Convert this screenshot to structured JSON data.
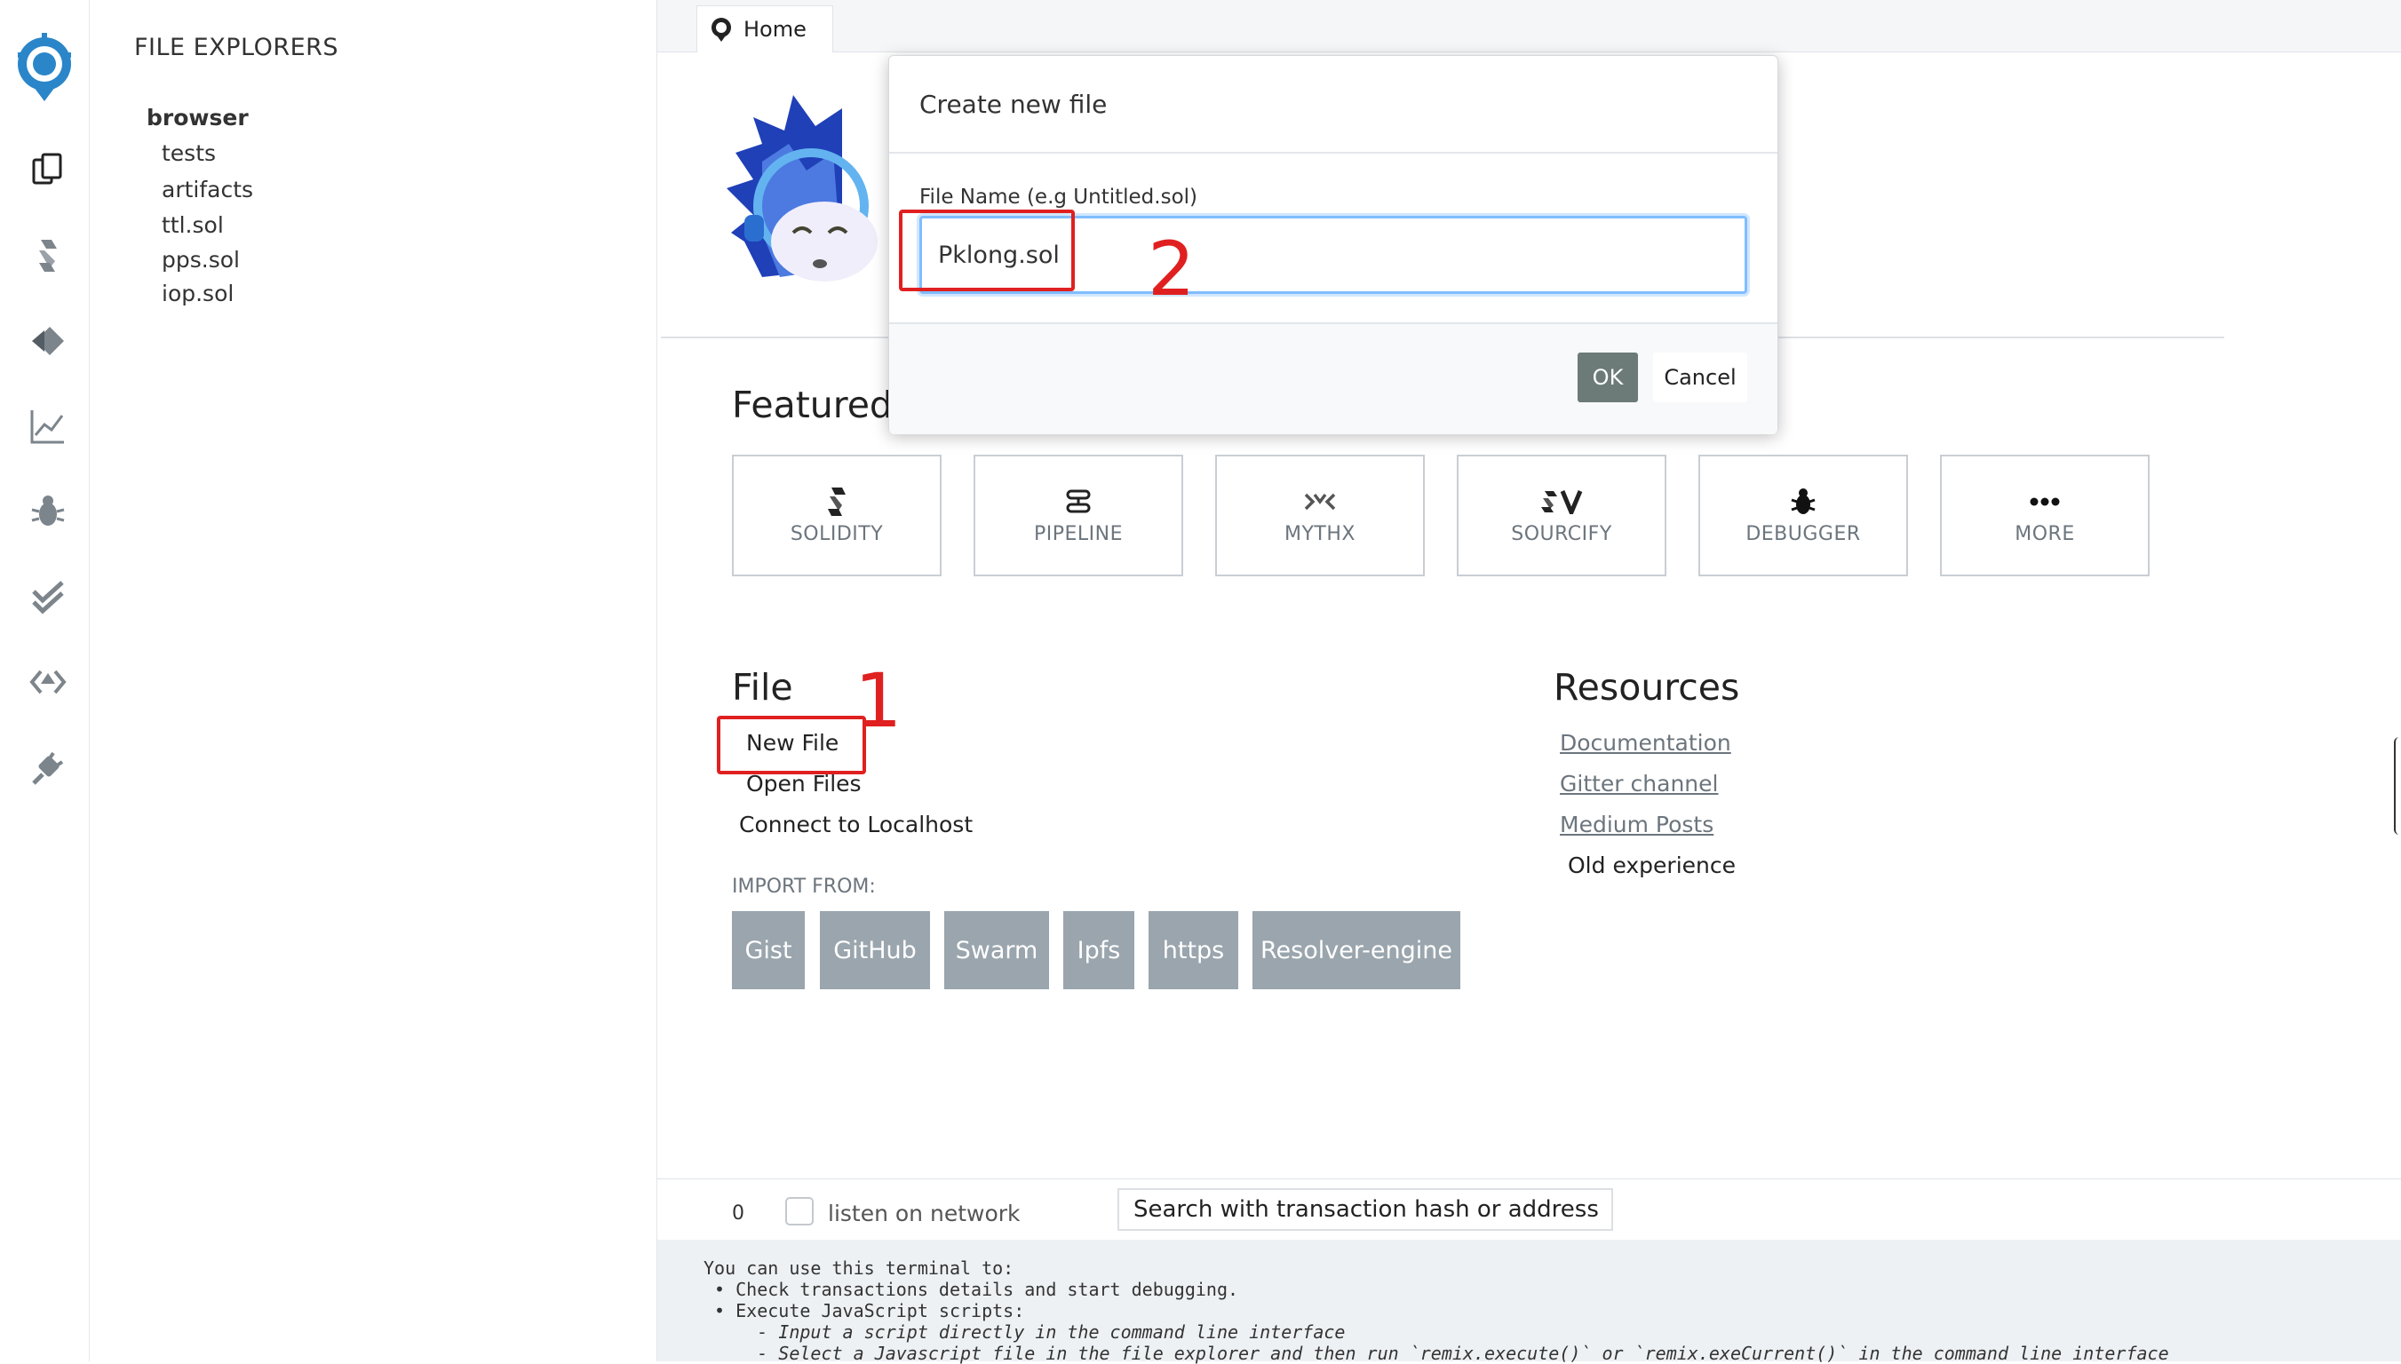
{
  "explorer": {
    "title": "FILE EXPLORERS",
    "root": "browser",
    "items": [
      "tests",
      "artifacts",
      "ttl.sol",
      "pps.sol",
      "iop.sol"
    ]
  },
  "tabs": [
    {
      "label": "Home"
    }
  ],
  "home": {
    "featured_title": "Featured",
    "plugins": [
      {
        "label": "SOLIDITY",
        "icon": "solidity-icon"
      },
      {
        "label": "PIPELINE",
        "icon": "pipeline-icon"
      },
      {
        "label": "MYTHX",
        "icon": "mythx-icon"
      },
      {
        "label": "SOURCIFY",
        "icon": "sourcify-icon"
      },
      {
        "label": "DEBUGGER",
        "icon": "bug-icon"
      },
      {
        "label": "MORE",
        "icon": "more-icon"
      }
    ],
    "file_title": "File",
    "file_links": [
      "New File",
      "Open Files",
      "Connect to Localhost"
    ],
    "import_label": "IMPORT FROM:",
    "import_buttons": [
      "Gist",
      "GitHub",
      "Swarm",
      "Ipfs",
      "https",
      "Resolver-engine"
    ],
    "resources_title": "Resources",
    "resource_links": [
      "Documentation",
      "Gitter channel",
      "Medium Posts"
    ],
    "old_experience": "Old experience"
  },
  "terminal": {
    "counter": "0",
    "listen_label": "listen on network",
    "search_placeholder": "Search with transaction hash or address",
    "lines": [
      "You can use this terminal to:",
      " • Check transactions details and start debugging.",
      " • Execute JavaScript scripts:",
      "     - Input a script directly in the command line interface",
      "     - Select a Javascript file in the file explorer and then run `remix.execute()` or `remix.exeCurrent()` in the command line interface"
    ]
  },
  "modal": {
    "title": "Create new file",
    "field_label": "File Name (e.g Untitled.sol)",
    "field_value": "Pklong.sol",
    "ok_label": "OK",
    "cancel_label": "Cancel"
  },
  "annotations": {
    "step1": "1",
    "step2": "2",
    "color": "#e02020"
  },
  "colors": {
    "brand": "#2c7fb8",
    "import_button": "#9aa5ad",
    "ok_button": "#6c7a78",
    "input_focus": "#80bdff"
  }
}
